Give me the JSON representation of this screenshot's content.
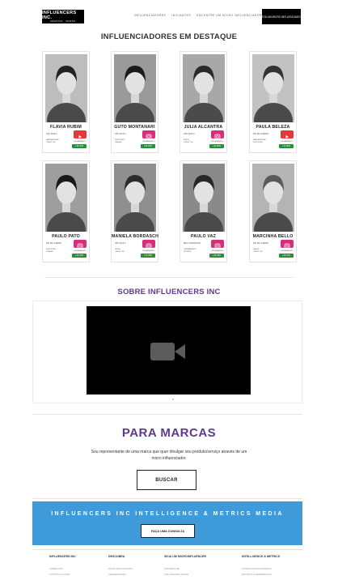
{
  "header": {
    "logo_line1": "INFLUENCERS INC.",
    "logo_line2": "NEGÓCIO · MUNDO",
    "nav": [
      "INFLUENCIADORES",
      "INICIANTES",
      "ENCONTRE UM MICRO INFLUENCIADOR",
      "LOGIN"
    ],
    "cta": "SEJA UM MICRO INFLUENCIADOR"
  },
  "featured": {
    "title": "INFLUENCIADORES EM DESTAQUE",
    "cards": [
      {
        "name": "FLAVIA RUBIM",
        "city": "SÃO PAULO",
        "cats": [
          "MATERNIDADE",
          "LIFESTYLE"
        ],
        "network": "youtube",
        "label": "ENGAJAMENTO",
        "badge": "+10.24%"
      },
      {
        "name": "GUTO MONTANARI",
        "city": "SÃO PAULO",
        "cats": [
          "ESPORTES",
          "VIAGEM"
        ],
        "network": "instagram",
        "label": "ENGAJAMENTO",
        "badge": "+10.24%"
      },
      {
        "name": "JULIA ALCANTRA",
        "city": "SÃO PAULO",
        "cats": [
          "MODA",
          "LIFESTYLE"
        ],
        "network": "instagram",
        "label": "ENGAJAMENTO",
        "badge": "+10.28%"
      },
      {
        "name": "PAULA BELEZA",
        "city": "RIO DE JANEIRO",
        "cats": [
          "MATERNIDADE",
          "ESPORTES"
        ],
        "network": "youtube",
        "label": "ENGAJAMENTO",
        "badge": "+11.29%"
      },
      {
        "name": "PAULO PATO",
        "city": "RIO DE JANEIRO",
        "cats": [
          "ESPORTES",
          "VIAGEM"
        ],
        "network": "instagram",
        "label": "ENGAJAMENTO",
        "badge": "+10.24%"
      },
      {
        "name": "MANIELA BORDASCH",
        "city": "SÃO PAULO",
        "cats": [
          "MODA",
          "LIFESTYLE"
        ],
        "network": "instagram",
        "label": "ENGAJAMENTO",
        "badge": "+17.28%"
      },
      {
        "name": "PAULO VAZ",
        "city": "BELO HORIZONTE",
        "cats": [
          "TREINAMENTO",
          "FITNESS"
        ],
        "network": "instagram",
        "label": "ENGAJAMENTO",
        "badge": "+18.33%"
      },
      {
        "name": "MARCINHA BELLO",
        "city": "RIO DE JANEIRO",
        "cats": [
          "SAÚDE",
          "LIFESTYLE"
        ],
        "network": "instagram",
        "label": "ENGAJAMENTO",
        "badge": "+16.22%"
      }
    ]
  },
  "about": {
    "title": "SOBRE INFLUENCERS INC"
  },
  "brands": {
    "title": "PARA MARCAS",
    "text": "Sou representante de uma marca que quer divulgar seu produto/serviço através de um micro influenciador.",
    "button": "BUSCAR"
  },
  "banner": {
    "title": "INFLUENCERS INC INTELLIGENCE & METRICS MEDIA",
    "button": "FAÇA UMA CONSULTA"
  },
  "footer": {
    "columns": [
      {
        "title": "INFLUENCERS INC",
        "links": [
          "SOBRE NÓS",
          "CONTATO & AJUDA"
        ]
      },
      {
        "title": "DESCUBRA",
        "links": [
          "MICRO INFLUENCERS",
          "CELEBRIDADES"
        ]
      },
      {
        "title": "SEJA UM MICROINFLUENCER",
        "links": [
          "INSCREVA-SE",
          "INFLUENCERS SAÚDE"
        ]
      },
      {
        "title": "INTELLIGENCE & METRICS",
        "links": [
          "CONSULTA ENGAJAMENTO",
          "ESTUDOS & REFERÊNCIAS"
        ]
      }
    ]
  },
  "colors": {
    "youtube": "#e53935",
    "instagram": "#d6307a",
    "badge": "#2e8b3a",
    "banner": "#3e9ad8",
    "marcas": "#5e3a8c"
  }
}
